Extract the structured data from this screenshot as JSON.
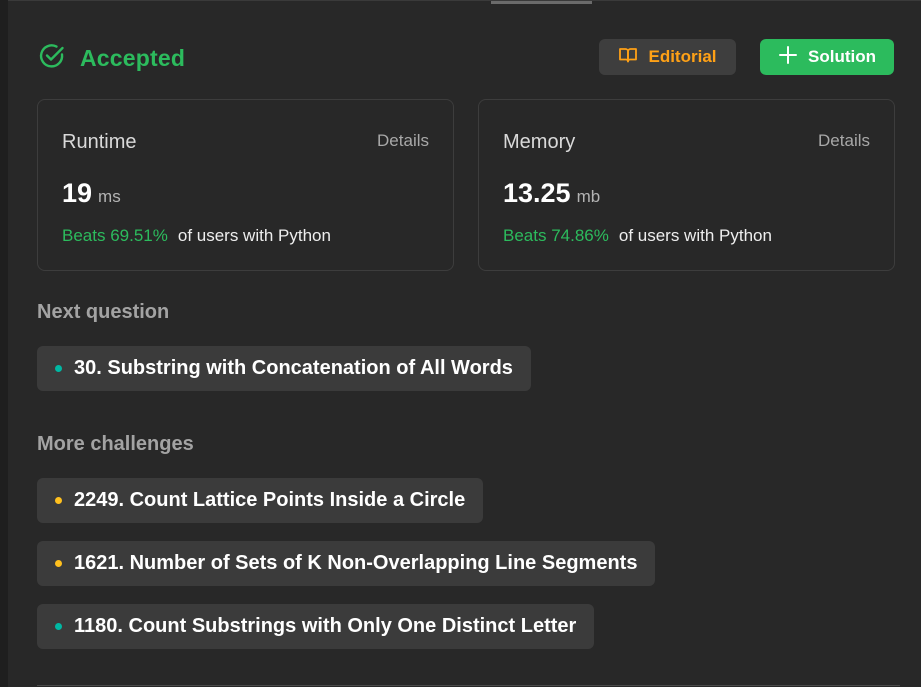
{
  "status": {
    "text": "Accepted"
  },
  "buttons": {
    "editorial": "Editorial",
    "solution": "Solution"
  },
  "runtime": {
    "title": "Runtime",
    "details": "Details",
    "value": "19",
    "unit": "ms",
    "beats": "Beats 69.51%",
    "beats_suffix": "of users with Python"
  },
  "memory": {
    "title": "Memory",
    "details": "Details",
    "value": "13.25",
    "unit": "mb",
    "beats": "Beats 74.86%",
    "beats_suffix": "of users with Python"
  },
  "next_question": {
    "title": "Next question",
    "item": {
      "label": "30. Substring with Concatenation of All Words",
      "difficulty": "easy-teal"
    }
  },
  "more_challenges": {
    "title": "More challenges",
    "items": [
      {
        "label": "2249. Count Lattice Points Inside a Circle",
        "difficulty": "medium-yellow"
      },
      {
        "label": "1621. Number of Sets of K Non-Overlapping Line Segments",
        "difficulty": "medium-yellow"
      },
      {
        "label": "1180. Count Substrings with Only One Distinct Letter",
        "difficulty": "easy-teal"
      }
    ]
  },
  "colors": {
    "accent_green": "#2cbb5d",
    "editorial_orange": "#ffa116",
    "easy_teal": "#00b8a3",
    "medium_yellow": "#ffc01e"
  },
  "icons": {
    "status": "check-circle-icon",
    "editorial": "book-icon",
    "solution": "plus-icon"
  }
}
